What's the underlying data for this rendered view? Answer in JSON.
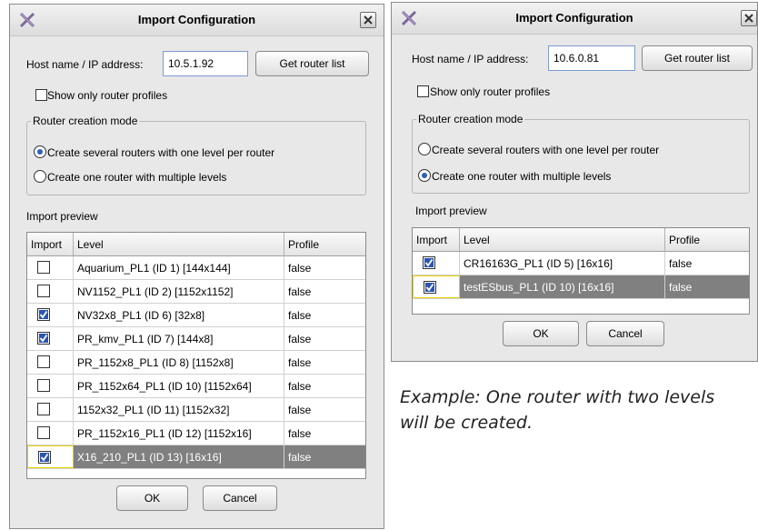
{
  "dialog1": {
    "title": "Import Configuration",
    "host_label": "Host name / IP address:",
    "host_value": "10.5.1.92",
    "get_router_list": "Get router list",
    "show_only_profiles": "Show only router profiles",
    "show_only_profiles_checked": false,
    "creation_mode_title": "Router creation mode",
    "mode_options": [
      {
        "label": "Create several routers with one level per router",
        "selected": true
      },
      {
        "label": "Create one router with multiple levels",
        "selected": false
      }
    ],
    "preview_title": "Import preview",
    "columns": [
      "Import",
      "Level",
      "Profile"
    ],
    "rows": [
      {
        "checked": false,
        "level": "Aquarium_PL1 (ID 1) [144x144]",
        "profile": "false",
        "selected": false
      },
      {
        "checked": false,
        "level": "NV1152_PL1 (ID 2) [1152x1152]",
        "profile": "false",
        "selected": false
      },
      {
        "checked": true,
        "level": "NV32x8_PL1 (ID 6) [32x8]",
        "profile": "false",
        "selected": false
      },
      {
        "checked": true,
        "level": "PR_kmv_PL1 (ID 7) [144x8]",
        "profile": "false",
        "selected": false
      },
      {
        "checked": false,
        "level": "PR_1152x8_PL1 (ID 8) [1152x8]",
        "profile": "false",
        "selected": false
      },
      {
        "checked": false,
        "level": "PR_1152x64_PL1 (ID 10) [1152x64]",
        "profile": "false",
        "selected": false
      },
      {
        "checked": false,
        "level": "1152x32_PL1 (ID 11) [1152x32]",
        "profile": "false",
        "selected": false
      },
      {
        "checked": false,
        "level": "PR_1152x16_PL1 (ID 12) [1152x16]",
        "profile": "false",
        "selected": false
      },
      {
        "checked": true,
        "level": "X16_210_PL1 (ID 13) [16x16]",
        "profile": "false",
        "selected": true
      }
    ],
    "ok": "OK",
    "cancel": "Cancel"
  },
  "dialog2": {
    "title": "Import Configuration",
    "host_label": "Host name / IP address:",
    "host_value": "10.6.0.81",
    "get_router_list": "Get router list",
    "show_only_profiles": "Show only router profiles",
    "show_only_profiles_checked": false,
    "creation_mode_title": "Router creation mode",
    "mode_options": [
      {
        "label": "Create several routers with one level per router",
        "selected": false
      },
      {
        "label": "Create one router with multiple levels",
        "selected": true
      }
    ],
    "preview_title": "Import preview",
    "columns": [
      "Import",
      "Level",
      "Profile"
    ],
    "rows": [
      {
        "checked": true,
        "level": "CR16163G_PL1 (ID 5) [16x16]",
        "profile": "false",
        "selected": false
      },
      {
        "checked": true,
        "level": "testESbus_PL1 (ID 10) [16x16]",
        "profile": "false",
        "selected": true
      }
    ],
    "ok": "OK",
    "cancel": "Cancel"
  },
  "caption": "Example: One router with two levels will be created.",
  "icons": {
    "app": "x-logo-icon",
    "close": "close-icon",
    "check": "checkmark-icon"
  },
  "colors": {
    "selected_row": "#808080",
    "check_mark": "#2a55b0",
    "radio_dot": "#2c5fb8"
  }
}
